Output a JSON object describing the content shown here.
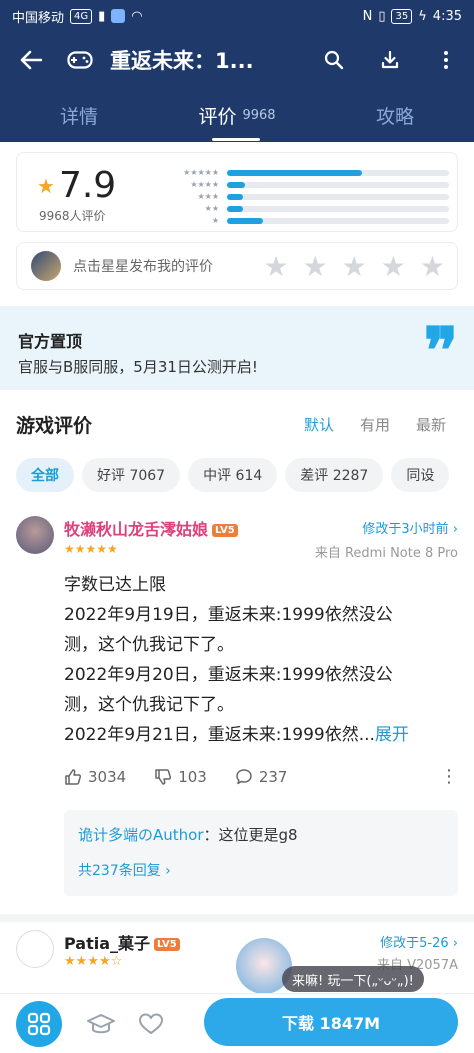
{
  "status_bar": {
    "carrier": "中国移动",
    "network": "4G",
    "battery": "35",
    "time": "4:35"
  },
  "app_bar": {
    "title": "重返未来：1..."
  },
  "tabs": [
    {
      "label": "详情",
      "count": ""
    },
    {
      "label": "评价",
      "count": "9968"
    },
    {
      "label": "攻略",
      "count": ""
    }
  ],
  "rating": {
    "score": "7.9",
    "count_text": "9968人评价",
    "distribution": [
      {
        "stars": "★★★★★",
        "fraction": 0.61
      },
      {
        "stars": "★★★★",
        "fraction": 0.08
      },
      {
        "stars": "★★★",
        "fraction": 0.07
      },
      {
        "stars": "★★",
        "fraction": 0.07
      },
      {
        "stars": "★",
        "fraction": 0.16
      }
    ]
  },
  "rate_prompt": {
    "text": "点击星星发布我的评价",
    "stars": [
      "★",
      "★",
      "★",
      "★",
      "★"
    ]
  },
  "pinned": {
    "heading": "官方置顶",
    "body": "官服与B服同服，5月31日公测开启!"
  },
  "reviews_section": {
    "title": "游戏评价",
    "sorts": [
      "默认",
      "有用",
      "最新"
    ]
  },
  "filters": [
    "全部",
    "好评 7067",
    "中评 614",
    "差评 2287",
    "同设"
  ],
  "review1": {
    "author": "牧濑秋山龙舌澪姑娘",
    "level": "LV5",
    "stars": "★★★★★",
    "modified": "修改于3小时前",
    "device": "来自 Redmi Note 8 Pro",
    "lines": [
      "字数已达上限",
      "2022年9月19日，重返未来:1999依然没公",
      "测，这个仇我记下了。",
      "2022年9月20日，重返未来:1999依然没公",
      "测，这个仇我记下了。",
      "2022年9月21日，重返未来:1999依然..."
    ],
    "expand": "展开",
    "likes": "3034",
    "dislikes": "103",
    "comments": "237",
    "reply_author": "诡计多端のAuthor",
    "reply_text": "：这位更是g8",
    "reply_count": "共237条回复"
  },
  "review2": {
    "author": "Patia_菓子",
    "level": "LV5",
    "stars": "★★★★☆",
    "modified": "修改于5-26",
    "device": "来自 V2057A"
  },
  "mascot": {
    "bubble": "来嘛! 玩一下(„ᵕᴗᵕ„)!"
  },
  "bottom_bar": {
    "download_label": "下载 1847M"
  },
  "colors": {
    "header_bg": "#1f3a6a",
    "accent": "#22a7e6",
    "star": "#f5a623",
    "author_pink": "#e0407a"
  }
}
